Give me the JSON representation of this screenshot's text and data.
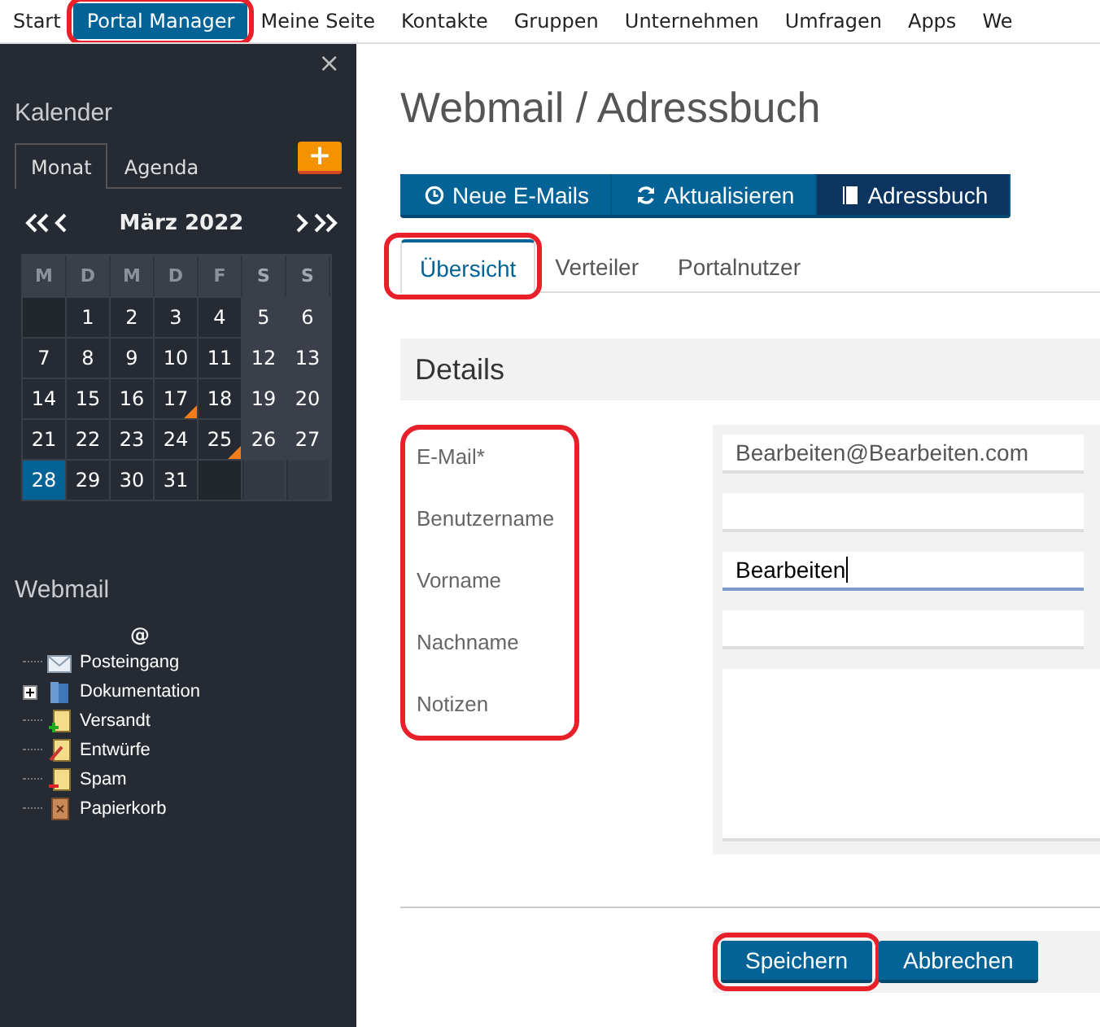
{
  "nav": {
    "items": [
      {
        "label": "Start",
        "selected": false,
        "highlighted": false
      },
      {
        "label": "Portal Manager",
        "selected": true,
        "highlighted": true
      },
      {
        "label": "Meine Seite",
        "selected": false,
        "highlighted": false
      },
      {
        "label": "Kontakte",
        "selected": false,
        "highlighted": false
      },
      {
        "label": "Gruppen",
        "selected": false,
        "highlighted": false
      },
      {
        "label": "Unternehmen",
        "selected": false,
        "highlighted": false
      },
      {
        "label": "Umfragen",
        "selected": false,
        "highlighted": false
      },
      {
        "label": "Apps",
        "selected": false,
        "highlighted": false
      },
      {
        "label": "We",
        "selected": false,
        "highlighted": false
      }
    ]
  },
  "sidebar": {
    "close": "×",
    "calendar": {
      "title": "Kalender",
      "tabs": [
        {
          "label": "Monat",
          "selected": true
        },
        {
          "label": "Agenda",
          "selected": false
        }
      ],
      "add_button": "+",
      "month": "März 2022",
      "weekdays": [
        {
          "label": "M",
          "weekend": false
        },
        {
          "label": "D",
          "weekend": false
        },
        {
          "label": "M",
          "weekend": false
        },
        {
          "label": "D",
          "weekend": false
        },
        {
          "label": "F",
          "weekend": false
        },
        {
          "label": "S",
          "weekend": true
        },
        {
          "label": "S",
          "weekend": true
        }
      ],
      "weeks": [
        [
          {
            "kind": "blank"
          },
          {
            "day": "1",
            "today": false,
            "marked": false
          },
          {
            "day": "2",
            "today": false,
            "marked": false
          },
          {
            "day": "3",
            "today": false,
            "marked": false
          },
          {
            "day": "4",
            "today": false,
            "marked": false
          },
          {
            "day": "5",
            "today": false,
            "marked": false
          },
          {
            "day": "6",
            "today": false,
            "marked": false
          }
        ],
        [
          {
            "day": "7",
            "today": false,
            "marked": false
          },
          {
            "day": "8",
            "today": false,
            "marked": false
          },
          {
            "day": "9",
            "today": false,
            "marked": false
          },
          {
            "day": "10",
            "today": false,
            "marked": false
          },
          {
            "day": "11",
            "today": false,
            "marked": false
          },
          {
            "day": "12",
            "today": false,
            "marked": false
          },
          {
            "day": "13",
            "today": false,
            "marked": false
          }
        ],
        [
          {
            "day": "14",
            "today": false,
            "marked": false
          },
          {
            "day": "15",
            "today": false,
            "marked": false
          },
          {
            "day": "16",
            "today": false,
            "marked": false
          },
          {
            "day": "17",
            "today": false,
            "marked": true
          },
          {
            "day": "18",
            "today": false,
            "marked": false
          },
          {
            "day": "19",
            "today": false,
            "marked": false
          },
          {
            "day": "20",
            "today": false,
            "marked": false
          }
        ],
        [
          {
            "day": "21",
            "today": false,
            "marked": false
          },
          {
            "day": "22",
            "today": false,
            "marked": false
          },
          {
            "day": "23",
            "today": false,
            "marked": false
          },
          {
            "day": "24",
            "today": false,
            "marked": false
          },
          {
            "day": "25",
            "today": false,
            "marked": true
          },
          {
            "day": "26",
            "today": false,
            "marked": false
          },
          {
            "day": "27",
            "today": false,
            "marked": false
          }
        ],
        [
          {
            "day": "28",
            "today": true,
            "marked": false
          },
          {
            "day": "29",
            "today": false,
            "marked": false
          },
          {
            "day": "30",
            "today": false,
            "marked": false
          },
          {
            "day": "31",
            "today": false,
            "marked": false
          },
          {
            "kind": "blank"
          },
          {
            "kind": "blank"
          },
          {
            "kind": "blank"
          }
        ]
      ]
    },
    "webmail": {
      "title": "Webmail",
      "account": "@",
      "folders": [
        {
          "label": "Posteingang",
          "kind": "inbox",
          "expandable": false
        },
        {
          "label": "Dokumentation",
          "kind": "docs",
          "expandable": true
        },
        {
          "label": "Versandt",
          "kind": "sent",
          "expandable": false
        },
        {
          "label": "Entwürfe",
          "kind": "drafts",
          "expandable": false
        },
        {
          "label": "Spam",
          "kind": "spam",
          "expandable": false
        },
        {
          "label": "Papierkorb",
          "kind": "trash",
          "expandable": false
        }
      ]
    }
  },
  "main": {
    "title": "Webmail / Adressbuch",
    "toolbar": [
      {
        "label": "Neue E-Mails",
        "selected": false
      },
      {
        "label": "Aktualisieren",
        "selected": false
      },
      {
        "label": "Adressbuch",
        "selected": true
      }
    ],
    "tabs": [
      {
        "label": "Übersicht",
        "selected": true,
        "highlighted": true
      },
      {
        "label": "Verteiler",
        "selected": false,
        "highlighted": false
      },
      {
        "label": "Portalnutzer",
        "selected": false,
        "highlighted": false
      }
    ],
    "section": "Details",
    "labels_highlighted": true,
    "fields": [
      {
        "label": "E-Mail*",
        "value": "Bearbeiten@Bearbeiten.com",
        "kind": "input",
        "focused": false
      },
      {
        "label": "Benutzername",
        "kind": "input",
        "focused": false
      },
      {
        "label": "Vorname",
        "value": "Bearbeiten",
        "kind": "input",
        "focused": true
      },
      {
        "label": "Nachname",
        "kind": "input",
        "focused": false
      },
      {
        "label": "Notizen",
        "kind": "textarea"
      }
    ],
    "buttons": [
      {
        "label": "Speichern",
        "highlighted": true
      },
      {
        "label": "Abbrechen",
        "highlighted": false
      }
    ]
  }
}
